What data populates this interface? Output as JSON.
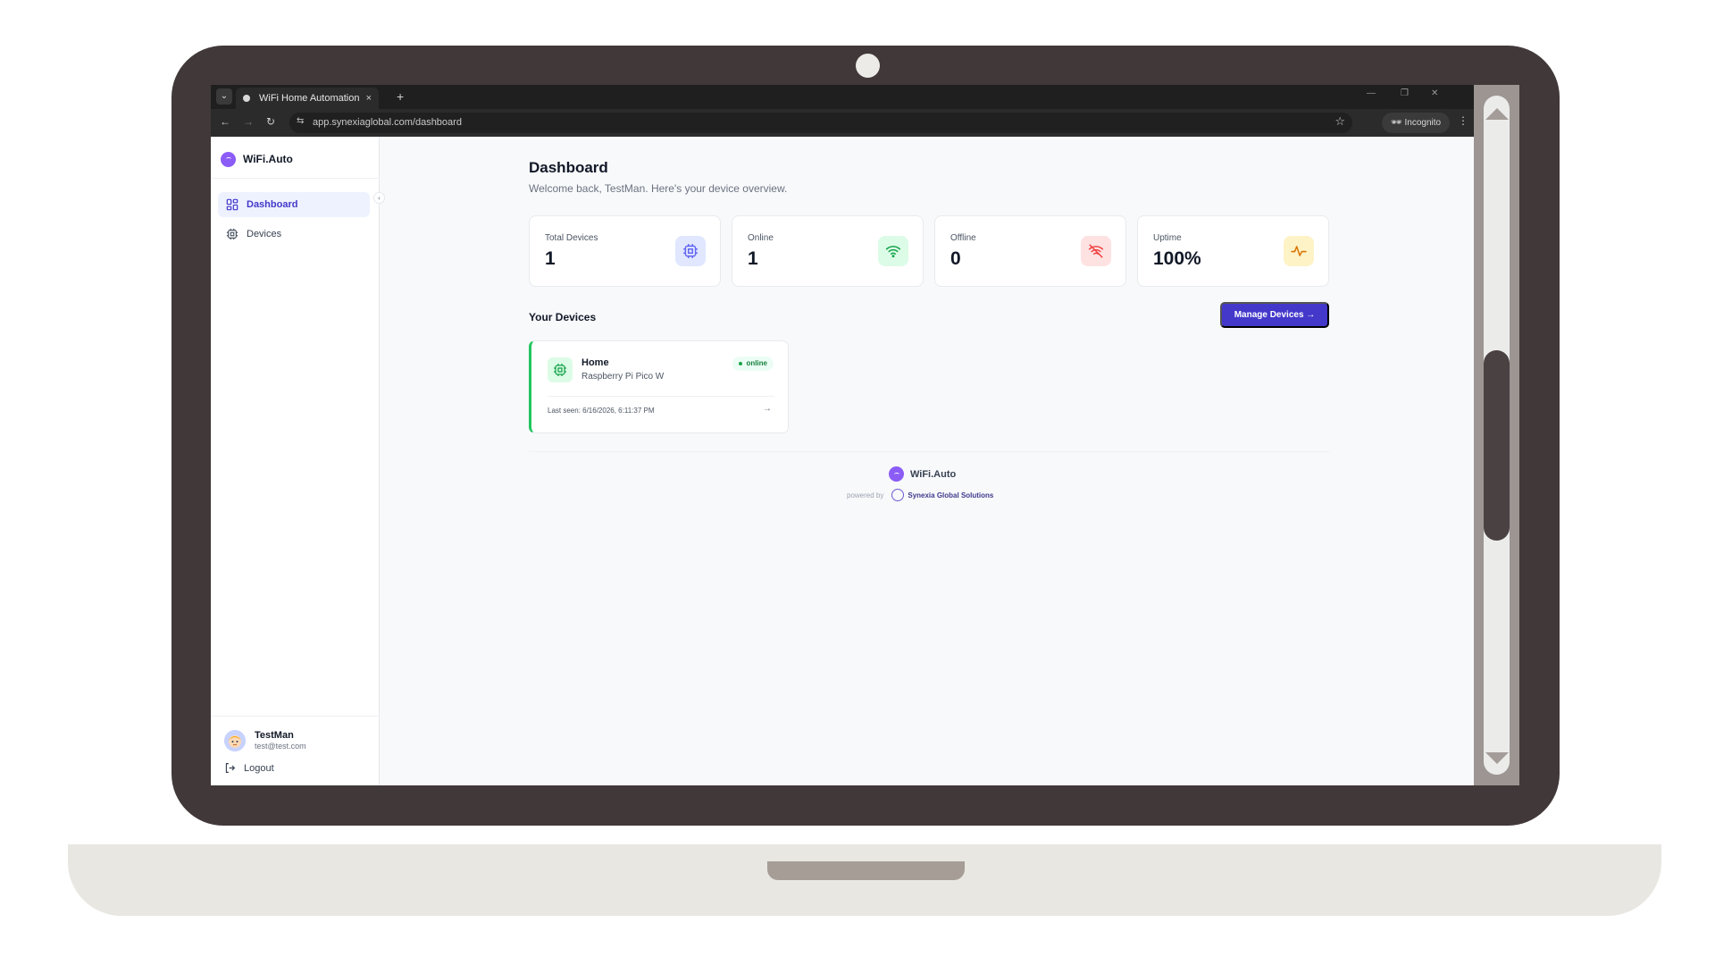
{
  "browser": {
    "tab_title": "WiFi Home Automation",
    "tab_close": "×",
    "new_tab": "+",
    "url": "app.synexiaglobal.com/dashboard",
    "incognito_label": "Incognito"
  },
  "sidebar": {
    "brand": "WiFi.Auto",
    "items": [
      {
        "label": "Dashboard",
        "icon": "dashboard-grid-icon",
        "active": true
      },
      {
        "label": "Devices",
        "icon": "chip-icon",
        "active": false
      }
    ],
    "user": {
      "name": "TestMan",
      "email": "test@test.com"
    },
    "logout_label": "Logout"
  },
  "main": {
    "title": "Dashboard",
    "subtitle": "Welcome back, TestMan. Here's your device overview.",
    "stats": [
      {
        "label": "Total Devices",
        "value": "1",
        "icon": "chip-icon",
        "color": "#6366f1",
        "bg": "#e0e7ff"
      },
      {
        "label": "Online",
        "value": "1",
        "icon": "wifi-icon",
        "color": "#16a34a",
        "bg": "#dcfce7"
      },
      {
        "label": "Offline",
        "value": "0",
        "icon": "wifi-off-icon",
        "color": "#ef4444",
        "bg": "#fee2e2"
      },
      {
        "label": "Uptime",
        "value": "100%",
        "icon": "activity-icon",
        "color": "#d97706",
        "bg": "#fef3c7"
      }
    ],
    "devices_title": "Your Devices",
    "manage_button": "Manage Devices →",
    "devices": [
      {
        "name": "Home",
        "model": "Raspberry Pi Pico W",
        "status": "online",
        "last_seen": "Last seen: 6/16/2026, 6:11:37 PM"
      }
    ],
    "footer": {
      "brand": "WiFi.Auto",
      "powered_by": "powered by",
      "company": "Synexia Global Solutions"
    }
  },
  "colors": {
    "accent": "#4338ca",
    "brand_purple": "#8b5cf6",
    "online_green": "#22c55e"
  }
}
